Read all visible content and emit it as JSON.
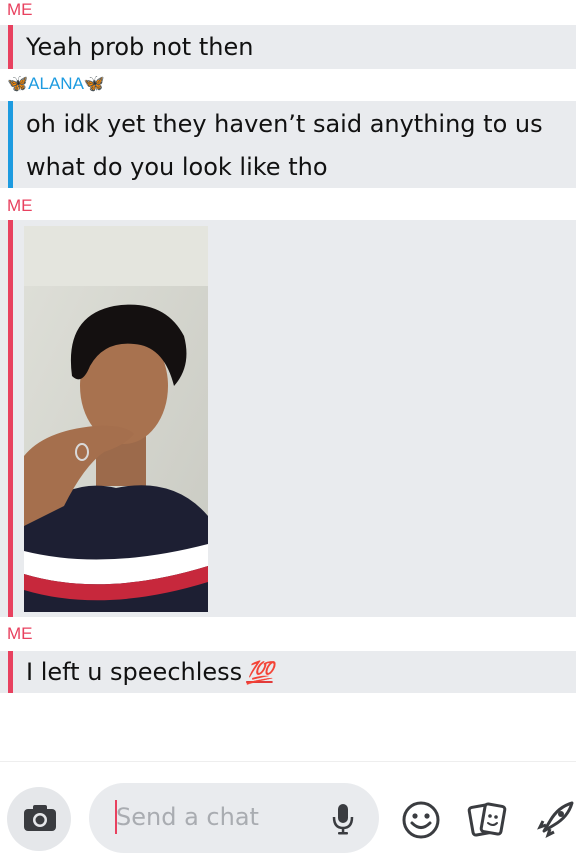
{
  "conversation": {
    "messages": [
      {
        "sender": "ME",
        "lines": [
          "Yeah prob not then"
        ]
      },
      {
        "sender": "🦋ALANA🦋",
        "lines": [
          "oh idk yet they haven’t said anything to us",
          "what do you look like tho"
        ]
      },
      {
        "sender": "ME",
        "type": "image"
      },
      {
        "sender": "ME",
        "lines": [
          "I left u speechless"
        ],
        "emoji": "💯"
      }
    ]
  },
  "composer": {
    "placeholder": "Send a chat",
    "camera_icon": "camera-icon",
    "mic_icon": "microphone-icon",
    "emoji_icon": "smiley-icon",
    "sticker_icon": "sticker-cards-icon",
    "games_icon": "rocket-icon"
  },
  "colors": {
    "me": "#e8415f",
    "them": "#1d9be0",
    "bubble_bg": "#e9ebee"
  }
}
